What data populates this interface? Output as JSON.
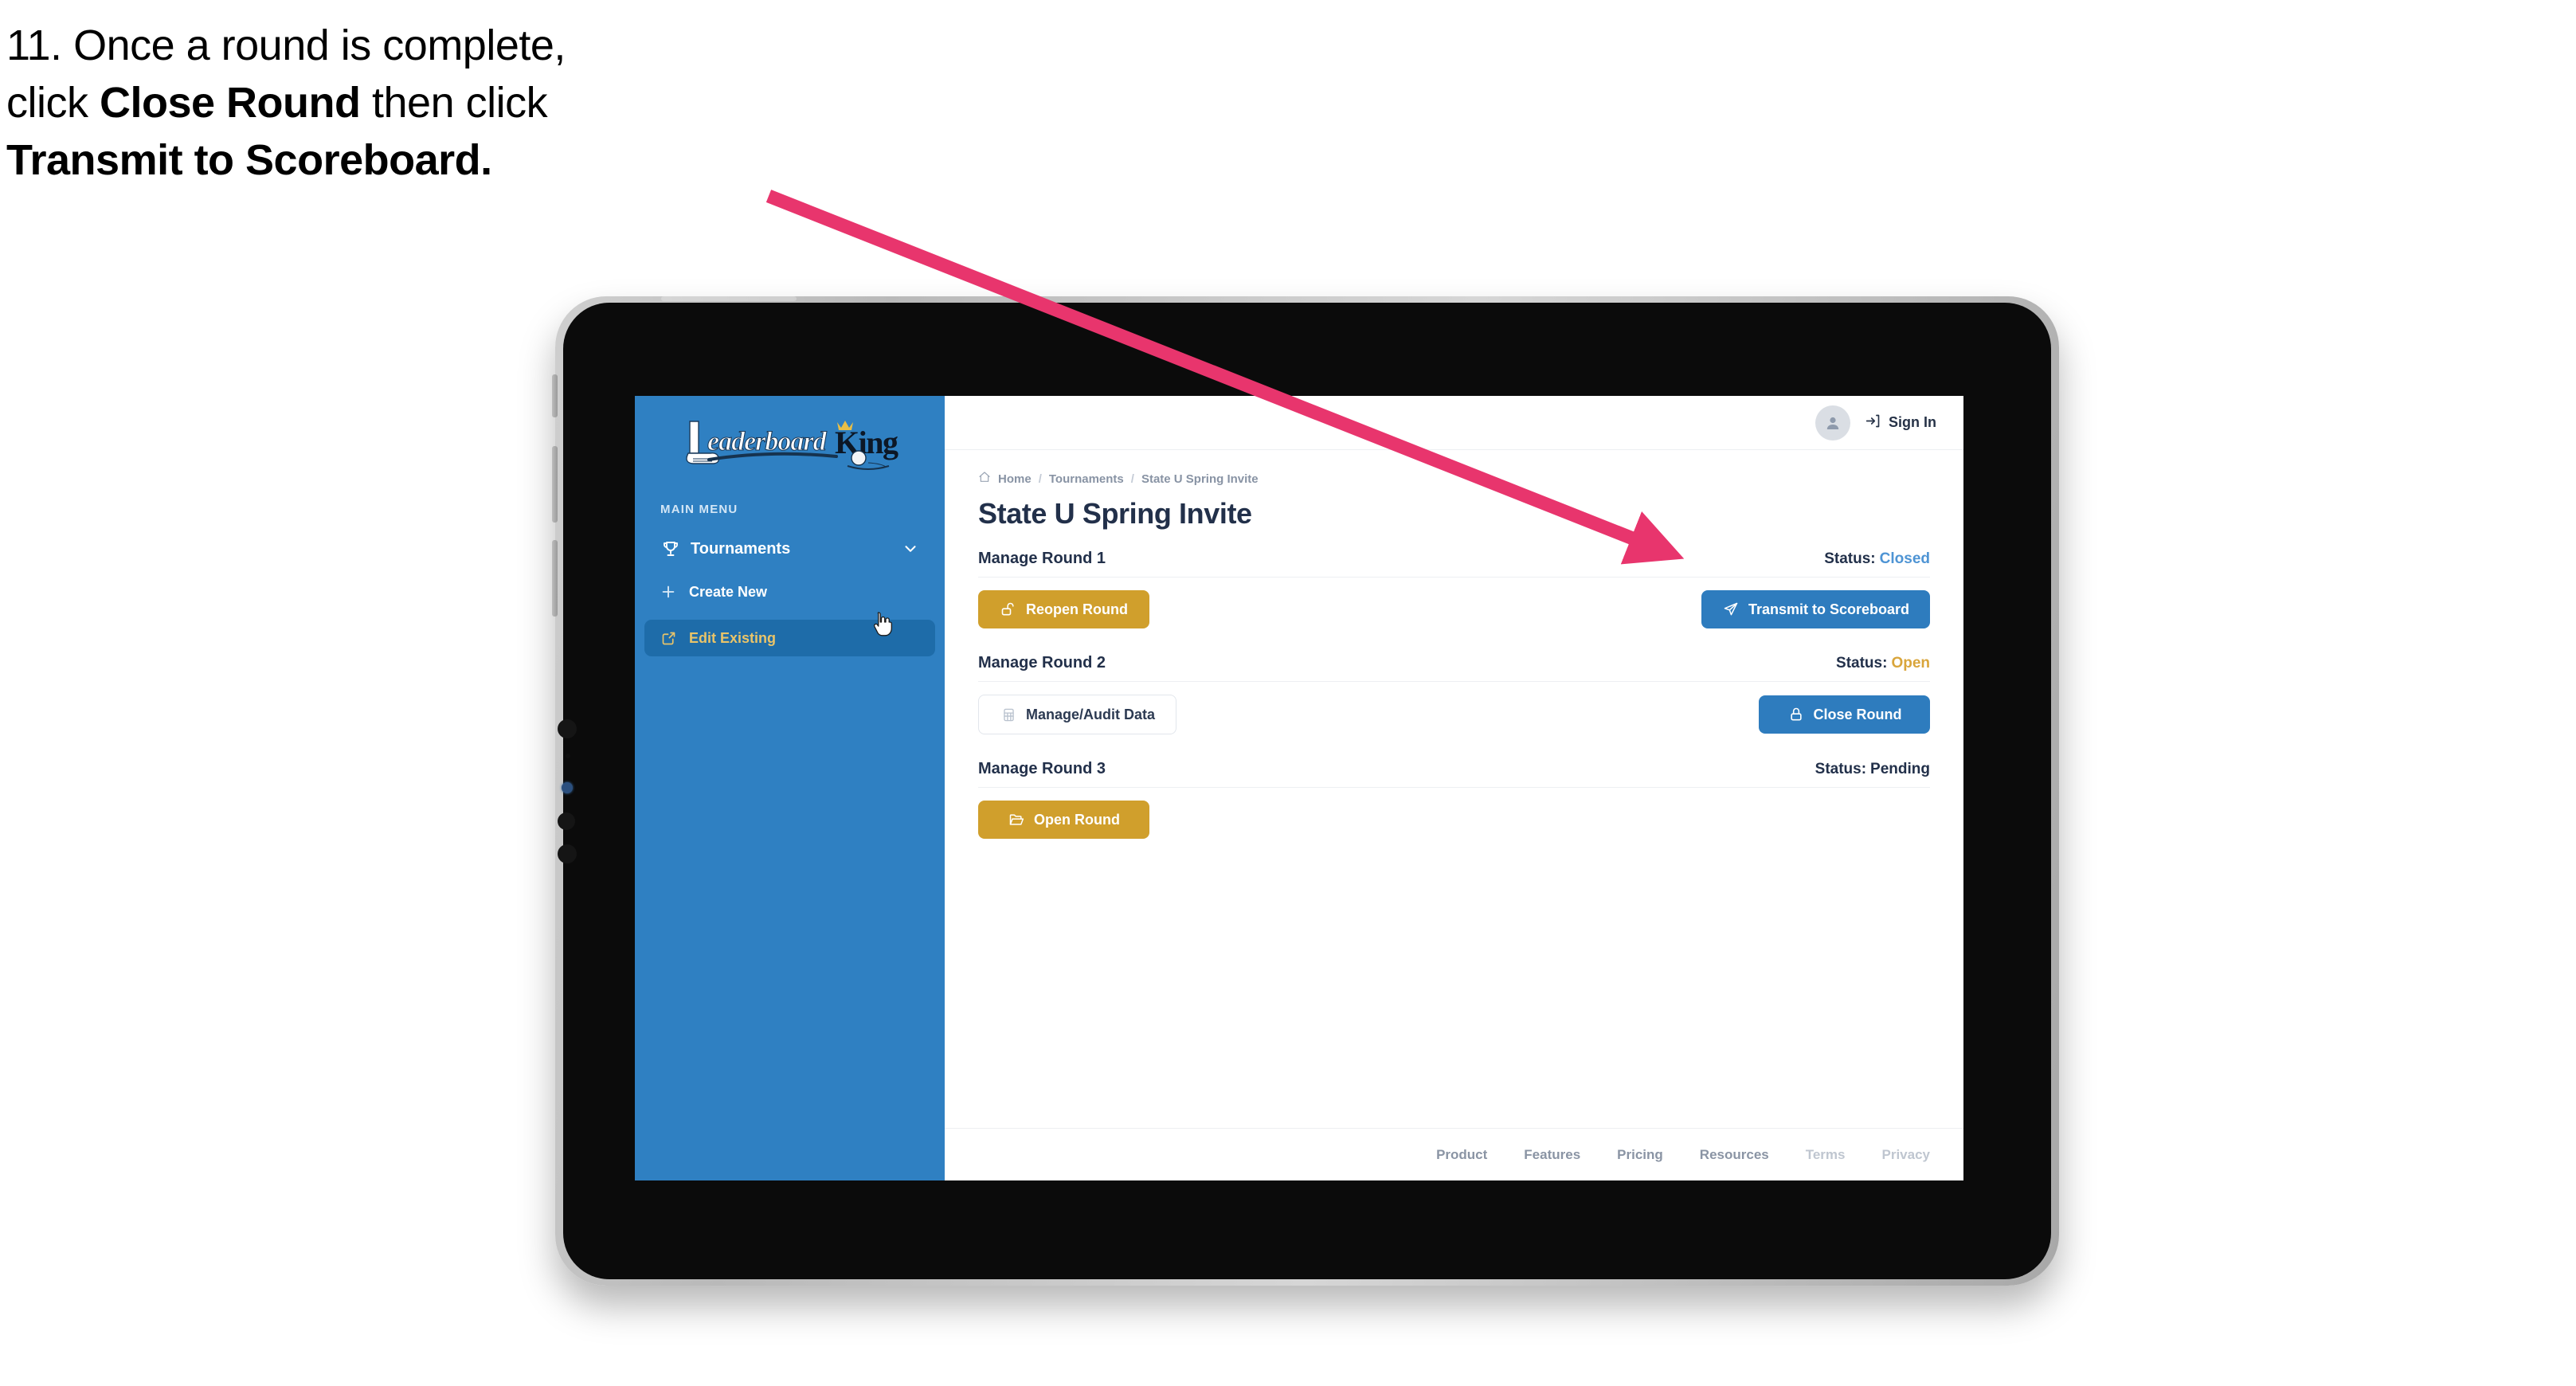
{
  "instruction": {
    "number": "11.",
    "line1_pre": "11. Once a round is complete,",
    "line2_pre": "click ",
    "line2_bold": "Close Round",
    "line2_post": " then click",
    "line3_bold": "Transmit to Scoreboard."
  },
  "annotation": {
    "arrow_color": "#E8356D",
    "points_to": "transmit-to-scoreboard-button"
  },
  "app": {
    "sidebar": {
      "logo_primary": "Leaderboard",
      "logo_secondary": "King",
      "menu_label": "MAIN MENU",
      "section": {
        "label": "Tournaments",
        "icon": "trophy-icon",
        "chevron": "chevron-down-icon"
      },
      "items": [
        {
          "label": "Create New",
          "icon": "plus-icon",
          "active": false
        },
        {
          "label": "Edit Existing",
          "icon": "edit-pencil-icon",
          "active": true
        }
      ],
      "bg_color": "#2F80C2",
      "active_bg_color": "#1E6CA9",
      "active_text_color": "#E9C469"
    },
    "topbar": {
      "avatar_icon": "user-avatar-icon",
      "signin_icon": "login-arrow-icon",
      "signin_label": "Sign In"
    },
    "breadcrumb": {
      "home_icon": "home-icon",
      "items": [
        "Home",
        "Tournaments",
        "State U Spring Invite"
      ],
      "separator": "/"
    },
    "page_title": "State U Spring Invite",
    "status_prefix": "Status:",
    "rounds": [
      {
        "name": "Manage Round 1",
        "status": "Closed",
        "status_class": "closed",
        "left_button": {
          "label": "Reopen Round",
          "icon": "unlock-icon",
          "style": "gold"
        },
        "right_button": {
          "label": "Transmit to Scoreboard",
          "icon": "paper-plane-icon",
          "style": "blue"
        }
      },
      {
        "name": "Manage Round 2",
        "status": "Open",
        "status_class": "open",
        "left_button": {
          "label": "Manage/Audit Data",
          "icon": "table-grid-icon",
          "style": "ghost"
        },
        "right_button": {
          "label": "Close Round",
          "icon": "lock-icon",
          "style": "blue"
        }
      },
      {
        "name": "Manage Round 3",
        "status": "Pending",
        "status_class": "pending",
        "left_button": {
          "label": "Open Round",
          "icon": "folder-open-icon",
          "style": "gold"
        },
        "right_button": null
      }
    ],
    "footer": {
      "links": [
        "Product",
        "Features",
        "Pricing",
        "Resources",
        "Terms",
        "Privacy"
      ]
    },
    "colors": {
      "gold": "#D09F2C",
      "blue": "#2E7CBE",
      "sidebar_blue": "#2F80C2",
      "title_navy": "#22304A",
      "status_closed": "#4E94D4",
      "status_open": "#D9A53B"
    }
  }
}
